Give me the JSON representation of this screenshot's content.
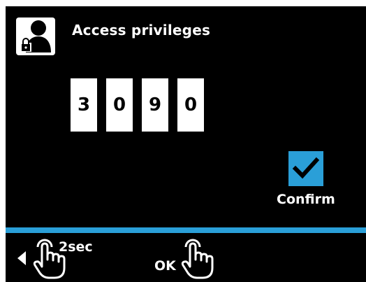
{
  "header": {
    "title": "Access privileges",
    "icon": "user-lock-icon"
  },
  "pin": {
    "digits": [
      "3",
      "0",
      "9",
      "0"
    ]
  },
  "confirm": {
    "label": "Confirm",
    "checked": true,
    "icon": "checkmark-icon"
  },
  "footer": {
    "back_icon": "left-arrow-icon",
    "hold_label": "2sec",
    "hold_icon": "touch-hand-icon",
    "ok_label": "OK",
    "ok_icon": "touch-hand-icon"
  },
  "colors": {
    "background": "#000000",
    "accent": "#2a9fd8",
    "text": "#ffffff"
  }
}
